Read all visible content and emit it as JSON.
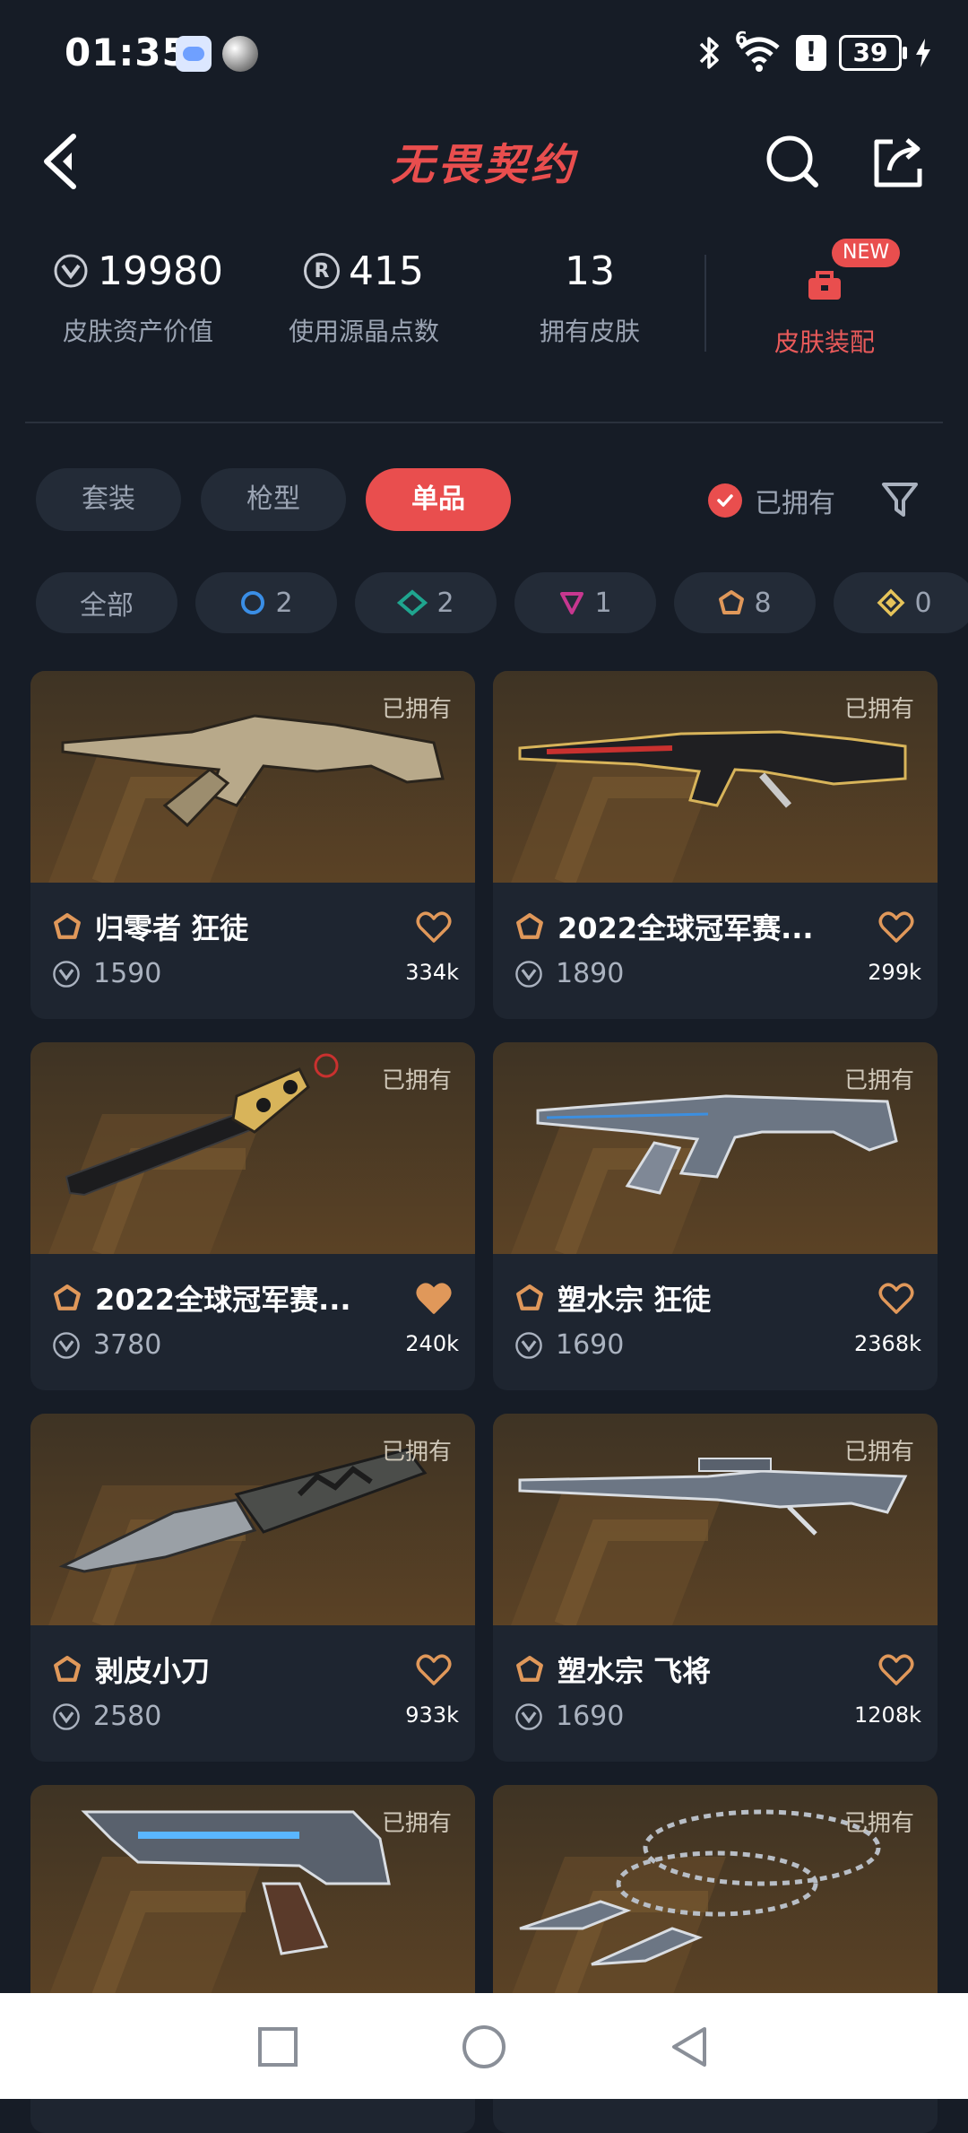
{
  "status_bar": {
    "time": "01:35",
    "signal_label": "6",
    "alert": "!",
    "battery": "39"
  },
  "header": {
    "title": "无畏契约"
  },
  "stats": {
    "asset_value": "19980",
    "asset_label": "皮肤资产价值",
    "points_value": "415",
    "points_label": "使用源晶点数",
    "skins_value": "13",
    "skins_label": "拥有皮肤",
    "coin_symbol": "R",
    "equip_label": "皮肤装配",
    "equip_badge": "NEW"
  },
  "tabs": [
    {
      "label": "套装",
      "active": false
    },
    {
      "label": "枪型",
      "active": false
    },
    {
      "label": "单品",
      "active": true
    }
  ],
  "owned_filter": {
    "label": "已拥有",
    "checked": true
  },
  "rarity_chips": [
    {
      "label": "全部",
      "icon": "all"
    },
    {
      "count": "2",
      "icon": "select-tier-icon",
      "color": "#3a8ee6"
    },
    {
      "count": "2",
      "icon": "deluxe-tier-icon",
      "color": "#1fa58f"
    },
    {
      "count": "1",
      "icon": "premium-tier-icon",
      "color": "#c7378f"
    },
    {
      "count": "8",
      "icon": "exclusive-tier-icon",
      "color": "#e0985a"
    },
    {
      "count": "0",
      "icon": "ultra-tier-icon",
      "color": "#e6c45a"
    }
  ],
  "cards": [
    {
      "name": "归零者 狂徒",
      "price": "1590",
      "likes": "334k",
      "tag": "已拥有",
      "liked": false
    },
    {
      "name": "2022全球冠军赛...",
      "price": "1890",
      "likes": "299k",
      "tag": "已拥有",
      "liked": false
    },
    {
      "name": "2022全球冠军赛...",
      "price": "3780",
      "likes": "240k",
      "tag": "已拥有",
      "liked": true
    },
    {
      "name": "塑水宗 狂徒",
      "price": "1690",
      "likes": "2368k",
      "tag": "已拥有",
      "liked": false
    },
    {
      "name": "剥皮小刀",
      "price": "2580",
      "likes": "933k",
      "tag": "已拥有",
      "liked": false
    },
    {
      "name": "塑水宗 飞将",
      "price": "1690",
      "likes": "1208k",
      "tag": "已拥有",
      "liked": false
    },
    {
      "name": "",
      "price": "",
      "likes": "",
      "tag": "已拥有",
      "liked": false
    },
    {
      "name": "",
      "price": "",
      "likes": "",
      "tag": "已拥有",
      "liked": false
    }
  ],
  "colors": {
    "accent": "#e94e4e",
    "tier_exclusive": "#e0985a",
    "background": "#161c26",
    "card_bg": "#1e2530"
  }
}
